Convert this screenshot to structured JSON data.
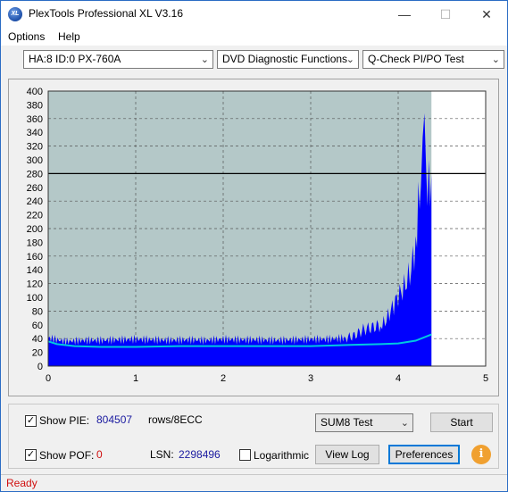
{
  "window": {
    "title": "PlexTools Professional XL V3.16",
    "app_icon_text": "XL",
    "minimize": "—",
    "maximize": "☐",
    "close": "✕"
  },
  "menu": {
    "options": "Options",
    "help": "Help"
  },
  "toolbar": {
    "drive": "HA:8 ID:0  PX-760A",
    "function": "DVD Diagnostic Functions",
    "test": "Q-Check PI/PO Test"
  },
  "chart_data": {
    "type": "bar",
    "title": "",
    "xlabel": "",
    "ylabel": "",
    "xlim": [
      0,
      5
    ],
    "ylim": [
      0,
      400
    ],
    "x_ticks": [
      "0",
      "1",
      "2",
      "3",
      "4",
      "5"
    ],
    "y_ticks": [
      "0",
      "20",
      "40",
      "60",
      "80",
      "100",
      "120",
      "140",
      "160",
      "180",
      "200",
      "220",
      "240",
      "260",
      "280",
      "300",
      "320",
      "340",
      "360",
      "380",
      "400"
    ],
    "threshold_line": 280,
    "data_end_x": 4.38,
    "colors": {
      "bars": "#0000ff",
      "average_line": "#00c8e0",
      "plot_bg": "#b4c8c8",
      "threshold": "#000000"
    },
    "series": [
      {
        "name": "",
        "type": "bar",
        "x": [
          0,
          0.2,
          0.4,
          0.6,
          0.8,
          1.0,
          1.2,
          1.4,
          1.6,
          1.8,
          2.0,
          2.2,
          2.4,
          2.6,
          2.8,
          3.0,
          3.2,
          3.4,
          3.5,
          3.6,
          3.7,
          3.8,
          3.85,
          3.9,
          3.95,
          4.0,
          4.05,
          4.1,
          4.15,
          4.2,
          4.23,
          4.26,
          4.28,
          4.3,
          4.32,
          4.35,
          4.38
        ],
        "values": [
          48,
          42,
          44,
          44,
          45,
          46,
          45,
          44,
          45,
          44,
          46,
          45,
          45,
          44,
          45,
          46,
          46,
          48,
          52,
          62,
          66,
          70,
          75,
          90,
          105,
          120,
          130,
          145,
          165,
          210,
          270,
          320,
          345,
          372,
          330,
          300,
          325
        ]
      },
      {
        "name": "",
        "type": "line",
        "x": [
          0,
          0.1,
          0.3,
          0.6,
          1.0,
          1.5,
          2.0,
          2.5,
          3.0,
          3.5,
          3.8,
          4.0,
          4.2,
          4.3,
          4.38
        ],
        "values": [
          36,
          32,
          29,
          28,
          28,
          29,
          29,
          29,
          29,
          31,
          32,
          33,
          37,
          42,
          46
        ]
      }
    ]
  },
  "bottom": {
    "show_pie_label": "Show PIE:",
    "pie_value": "804507",
    "pie_unit": "rows/8ECC",
    "show_pof_label": "Show POF:",
    "pof_value": "0",
    "lsn_label": "LSN:",
    "lsn_value": "2298496",
    "logarithmic_label": "Logarithmic",
    "sum_select": "SUM8 Test",
    "start_button": "Start",
    "view_log_button": "View Log",
    "preferences_button": "Preferences",
    "info_icon": "i"
  },
  "status": {
    "text": "Ready"
  }
}
